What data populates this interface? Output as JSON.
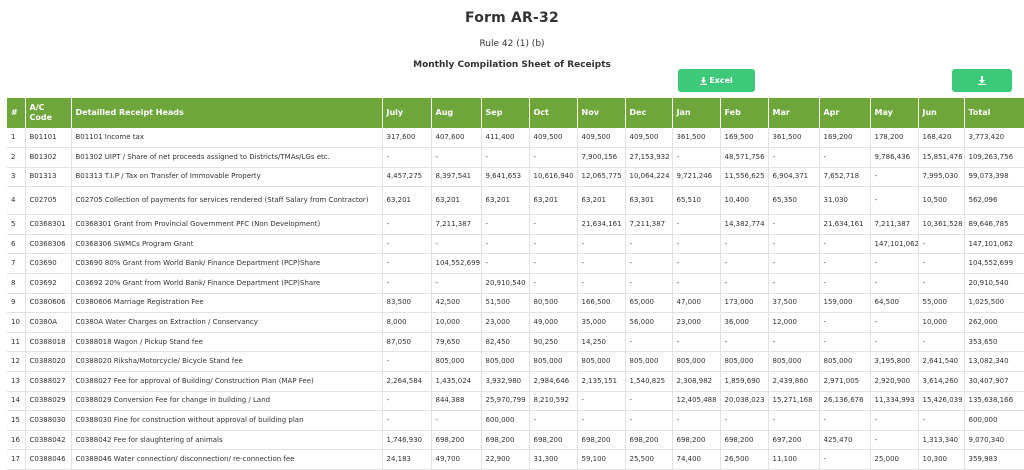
{
  "header": {
    "title": "Form AR-32",
    "rule": "Rule 42 (1) (b)",
    "subtitle": "Monthly Compilation Sheet of Receipts"
  },
  "buttons": {
    "excel_label": "Excel",
    "download_icon": "download-icon"
  },
  "colors": {
    "table_header": "#6ea63b",
    "button": "#3dc97a"
  },
  "table": {
    "columns": [
      "#",
      "A/C Code",
      "Detailled Receipt Heads",
      "July",
      "Aug",
      "Sep",
      "Oct",
      "Nov",
      "Dec",
      "Jan",
      "Feb",
      "Mar",
      "Apr",
      "May",
      "Jun",
      "Total"
    ],
    "rows": [
      [
        "1",
        "B01101",
        "B01101 Income tax",
        "317,600",
        "407,600",
        "411,400",
        "409,500",
        "409,500",
        "409,500",
        "361,500",
        "169,500",
        "361,500",
        "169,200",
        "178,200",
        "168,420",
        "3,773,420"
      ],
      [
        "2",
        "B01302",
        "B01302 UIPT / Share of net proceeds assigned to Districts/TMAs/LGs etc.",
        "-",
        "-",
        "-",
        "-",
        "7,900,156",
        "27,153,932",
        "-",
        "48,571,756",
        "-",
        "-",
        "9,786,436",
        "15,851,476",
        "109,263,756"
      ],
      [
        "3",
        "B01313",
        "B01313 T.I.P / Tax on Transfer of Immovable Property",
        "4,457,275",
        "8,397,541",
        "9,641,653",
        "10,616,940",
        "12,065,775",
        "10,064,224",
        "9,721,246",
        "11,556,625",
        "6,904,371",
        "7,652,718",
        "-",
        "7,995,030",
        "99,073,398"
      ],
      [
        "4",
        "C02705",
        "C02705 Collection of payments for services rendered (Staff Salary from Contractor)",
        "63,201",
        "63,201",
        "63,201",
        "63,201",
        "63,201",
        "63,301",
        "65,510",
        "10,400",
        "65,350",
        "31,030",
        "-",
        "10,500",
        "562,096"
      ],
      [
        "5",
        "C0368301",
        "C0368301 Grant from Provincial Government PFC (Non Development)",
        "-",
        "7,211,387",
        "-",
        "-",
        "21,634,161",
        "7,211,387",
        "-",
        "14,382,774",
        "-",
        "21,634,161",
        "7,211,387",
        "10,361,528",
        "89,646,785"
      ],
      [
        "6",
        "C0368306",
        "C0368306 SWMCs Program Grant",
        "-",
        "-",
        "-",
        "-",
        "-",
        "-",
        "-",
        "-",
        "-",
        "-",
        "147,101,062",
        "-",
        "147,101,062"
      ],
      [
        "7",
        "C03690",
        "C03690 80% Grant from World Bank/ Finance Department (PCP)Share",
        "-",
        "104,552,699",
        "-",
        "-",
        "-",
        "-",
        "-",
        "-",
        "-",
        "-",
        "-",
        "-",
        "104,552,699"
      ],
      [
        "8",
        "C03692",
        "C03692 20% Grant from World Bank/ Finance Department (PCP)Share",
        "-",
        "-",
        "20,910,540",
        "-",
        "-",
        "-",
        "-",
        "-",
        "-",
        "-",
        "-",
        "-",
        "20,910,540"
      ],
      [
        "9",
        "C0380606",
        "C0380606 Marriage Registration Fee",
        "83,500",
        "42,500",
        "51,500",
        "80,500",
        "166,500",
        "65,000",
        "47,000",
        "173,000",
        "37,500",
        "159,000",
        "64,500",
        "55,000",
        "1,025,500"
      ],
      [
        "10",
        "C0380A",
        "C0380A Water Charges on Extraction / Conservancy",
        "8,000",
        "10,000",
        "23,000",
        "49,000",
        "35,000",
        "56,000",
        "23,000",
        "36,000",
        "12,000",
        "-",
        "-",
        "10,000",
        "262,000"
      ],
      [
        "11",
        "C0388018",
        "C0388018 Wagon / Pickup Stand fee",
        "87,050",
        "79,650",
        "82,450",
        "90,250",
        "14,250",
        "-",
        "-",
        "-",
        "-",
        "-",
        "-",
        "-",
        "353,650"
      ],
      [
        "12",
        "C0388020",
        "C0388020 Riksha/Motorcycle/ Bicycle Stand fee",
        "-",
        "805,000",
        "805,000",
        "805,000",
        "805,000",
        "805,000",
        "805,000",
        "805,000",
        "805,000",
        "805,000",
        "3,195,800",
        "2,641,540",
        "13,082,340"
      ],
      [
        "13",
        "C0388027",
        "C0388027 Fee for approval of Building/ Construction Plan (MAP Fee)",
        "2,264,584",
        "1,435,024",
        "3,932,980",
        "2,984,646",
        "2,135,151",
        "1,540,825",
        "2,308,982",
        "1,859,690",
        "2,439,860",
        "2,971,005",
        "2,920,900",
        "3,614,260",
        "30,407,907"
      ],
      [
        "14",
        "C0388029",
        "C0388029 Conversion Fee for change in building / Land",
        "-",
        "844,388",
        "25,970,799",
        "8,210,592",
        "-",
        "-",
        "12,405,488",
        "20,038,023",
        "15,271,168",
        "26,136,676",
        "11,334,993",
        "15,426,039",
        "135,638,166"
      ],
      [
        "15",
        "C0388030",
        "C0388030 Fine for construction without approval of building plan",
        "-",
        "-",
        "600,000",
        "-",
        "-",
        "-",
        "-",
        "-",
        "-",
        "-",
        "-",
        "-",
        "600,000"
      ],
      [
        "16",
        "C0388042",
        "C0388042 Fee for slaughtering of animals",
        "1,746,930",
        "698,200",
        "698,200",
        "698,200",
        "698,200",
        "698,200",
        "698,200",
        "698,200",
        "697,200",
        "425,470",
        "-",
        "1,313,340",
        "9,070,340"
      ],
      [
        "17",
        "C0388046",
        "C0388046 Water connection/ disconnection/ re-connection fee",
        "24,183",
        "49,700",
        "22,900",
        "31,300",
        "59,100",
        "25,500",
        "74,400",
        "26,500",
        "11,100",
        "-",
        "25,000",
        "10,300",
        "359,983"
      ]
    ]
  }
}
